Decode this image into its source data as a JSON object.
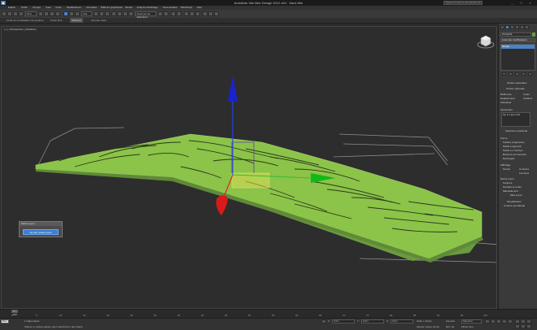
{
  "window": {
    "title": "Autodesk 3ds Max Design 2012 x64 · Sans titre",
    "search_placeholder": "Tapez un mot ou une phrase clé"
  },
  "menu": [
    "Edition",
    "Outils",
    "Groupe",
    "Vues",
    "Créer",
    "Modificateurs",
    "Animation",
    "Éditeurs graphiques",
    "Rendu",
    "Analyse d'éclairage",
    "Personnaliser",
    "MAXScript",
    "Aide"
  ],
  "toolbar": {
    "selection_filter": "Tout",
    "view_dropdown": "Vue",
    "named_selection": "Créer jeu de sélections"
  },
  "ribbon_tabs": [
    "Outils de modélisation de graphite",
    "Droite libre",
    "Sélection",
    "Peinture objet"
  ],
  "viewport": {
    "label": "[ + ] [ Perspective ] [ Réaliste ]"
  },
  "panel": {
    "object_name": "Terrain01",
    "modifier_list_label": "Liste des modificateurs",
    "stack_item": "Terrain",
    "section_pick": "Choisir opérandes",
    "pick_button": "Choisir opérande",
    "radio_reference": "Référence",
    "radio_copy": "Copie",
    "radio_move": "Déplacement",
    "radio_instance": "Instance",
    "radio_overwrite": "Substituer",
    "operands_label": "Opérandes",
    "operand_item": "Op 0: Ligne 001",
    "delete_operand": "Supprimer opérande",
    "form_label": "Forme",
    "form_graded_surface": "Surface progressive",
    "form_graded_solid": "Solide progressif",
    "form_layered_solid": "Solide en couches",
    "form_stitch": "Bordures de raccordé",
    "form_retriangulate": "Retriangler",
    "display_label": "Affichage",
    "display_terrain": "Terrain",
    "display_contour": "Contours",
    "display_both": "Les deux",
    "update_label": "Mettre à jour",
    "update_always": "Toujours",
    "update_render": "Pendant le rendu",
    "update_manual": "Manuellement",
    "update_button": "Mise à jour",
    "simplification": "Simplification",
    "color_by_elevation": "Couleur par altitude"
  },
  "dialog": {
    "title": "Mettre à jour",
    "button": "Ne pas mettre à jour"
  },
  "timeline": {
    "frame": "0 / 100",
    "ticks": [
      "0",
      "5",
      "10",
      "15",
      "20",
      "25",
      "30",
      "35",
      "40",
      "45",
      "50",
      "55",
      "60",
      "65",
      "70",
      "75",
      "80",
      "85",
      "90",
      "95",
      "100"
    ]
  },
  "status": {
    "selected": "1 Objet sélect.",
    "prompt": "Cliquer ou cliquer-glisser pour sélectionner des objets",
    "x_label": "X:",
    "x_value": "0,0m",
    "y_label": "Y:",
    "y_value": "0,0m",
    "z_label": "Z:",
    "z_value": "0,0m",
    "grid": "Grille = 10,0m",
    "autokey": "Clé auto",
    "selection_dropdown": "Sélection",
    "set_key": "Déf. clé",
    "key_filters": "Filtres clés...",
    "add_time_tag": "Ajouter repère temps",
    "script_label": "Bien. Chargement du monde..."
  }
}
